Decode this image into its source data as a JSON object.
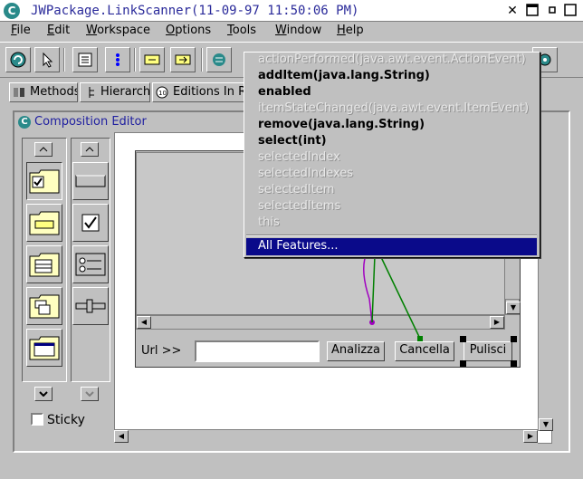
{
  "window": {
    "title": "JWPackage.LinkScanner(11-09-97 11:50:06 PM)",
    "icon_letter": "C",
    "controls": [
      "close-icon",
      "minimize-icon",
      "maximize-icon"
    ]
  },
  "menubar": {
    "items": [
      "File",
      "Edit",
      "Workspace",
      "Options",
      "Tools",
      "Window",
      "Help"
    ]
  },
  "tabs": [
    {
      "label": "Methods"
    },
    {
      "label": "Hierarchy"
    },
    {
      "label": "Editions In Rep"
    }
  ],
  "editor": {
    "title": "Composition Editor",
    "icon_letter": "C",
    "sticky_label": "Sticky",
    "sticky_checked": false
  },
  "form": {
    "url_label": "Url >>",
    "url_value": "",
    "buttons": [
      "Analizza",
      "Cancella",
      "Pulisci"
    ]
  },
  "popup_menu": {
    "items": [
      {
        "label": "actionPerformed(java.awt.event.ActionEvent)",
        "enabled": false
      },
      {
        "label": "addItem(java.lang.String)",
        "enabled": true
      },
      {
        "label": "enabled",
        "enabled": true
      },
      {
        "label": "itemStateChanged(java.awt.event.ItemEvent)",
        "enabled": false
      },
      {
        "label": "remove(java.lang.String)",
        "enabled": true
      },
      {
        "label": "select(int)",
        "enabled": true
      },
      {
        "label": "selectedIndex",
        "enabled": false
      },
      {
        "label": "selectedIndexes",
        "enabled": false
      },
      {
        "label": "selectedItem",
        "enabled": false
      },
      {
        "label": "selectedItems",
        "enabled": false
      },
      {
        "label": "this",
        "enabled": false
      }
    ],
    "highlighted": "All Features..."
  },
  "colors": {
    "title_text": "#2a2a9a",
    "highlight": "#0a0a8a",
    "connection_purple": "#a000c0",
    "connection_green": "#008000"
  }
}
